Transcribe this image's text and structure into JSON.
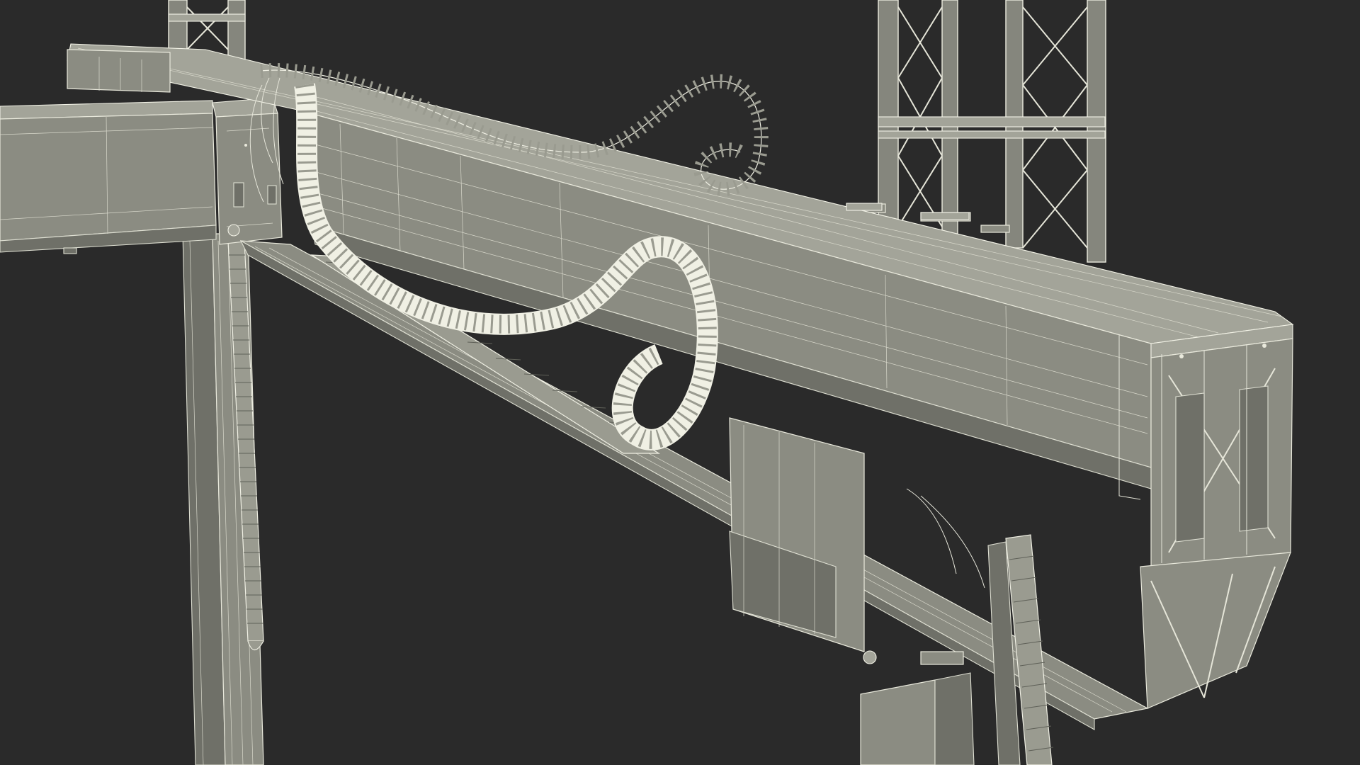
{
  "scene": {
    "background": "#2a2a2a",
    "model_color": "#8b8c82",
    "wire_color": "#e9e9dc"
  }
}
